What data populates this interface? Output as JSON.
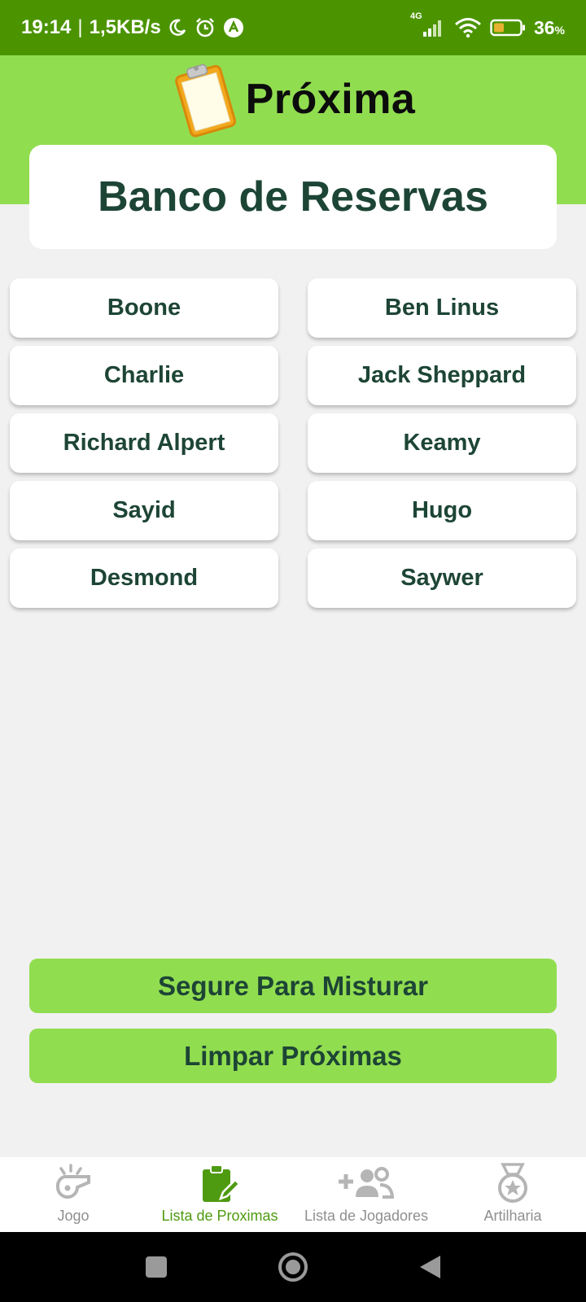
{
  "status_bar": {
    "time": "19:14",
    "separator": "|",
    "speed": "1,5KB/s",
    "network": "4G",
    "battery_percent": "36",
    "battery_unit": "%"
  },
  "header": {
    "title": "Próxima",
    "icon": "clipboard-icon"
  },
  "bench": {
    "title": "Banco de Reservas"
  },
  "players": [
    {
      "name": "Boone"
    },
    {
      "name": "Ben Linus"
    },
    {
      "name": "Charlie"
    },
    {
      "name": "Jack Sheppard"
    },
    {
      "name": "Richard Alpert"
    },
    {
      "name": "Keamy"
    },
    {
      "name": "Sayid"
    },
    {
      "name": "Hugo"
    },
    {
      "name": "Desmond"
    },
    {
      "name": "Saywer"
    }
  ],
  "actions": {
    "shuffle_label": "Segure Para Misturar",
    "clear_label": "Limpar Próximas"
  },
  "bottom_nav": [
    {
      "label": "Jogo",
      "icon": "whistle-icon",
      "active": false
    },
    {
      "label": "Lista de Proximas",
      "icon": "clipboard-edit-icon",
      "active": true
    },
    {
      "label": "Lista de Jogadores",
      "icon": "add-group-icon",
      "active": false
    },
    {
      "label": "Artilharia",
      "icon": "medal-icon",
      "active": false
    }
  ],
  "colors": {
    "status_bar": "#4b9400",
    "header": "#91dd50",
    "text_dark_green": "#1d4535",
    "active_nav": "#4e9a10",
    "inactive_nav": "#8f8f8f"
  }
}
